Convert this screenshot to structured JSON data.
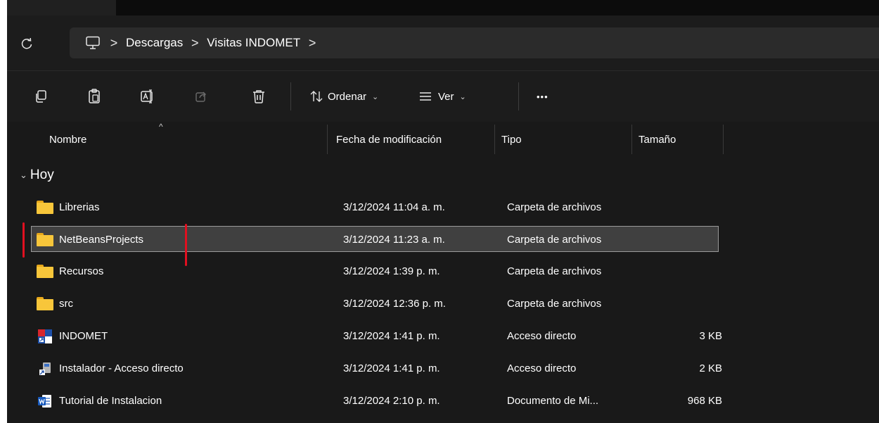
{
  "address": {
    "crumbs": [
      "Descargas",
      "Visitas INDOMET"
    ],
    "separator": ">"
  },
  "toolbar": {
    "sort_label": "Ordenar",
    "view_label": "Ver",
    "more_label": "•••"
  },
  "columns": {
    "name": "Nombre",
    "date": "Fecha de modificación",
    "type": "Tipo",
    "size": "Tamaño"
  },
  "group": {
    "label": "Hoy"
  },
  "files": [
    {
      "name": "Librerias",
      "date": "3/12/2024 11:04 a. m.",
      "type": "Carpeta de archivos",
      "size": "",
      "icon": "folder-icon"
    },
    {
      "name": "NetBeansProjects",
      "date": "3/12/2024 11:23 a. m.",
      "type": "Carpeta de archivos",
      "size": "",
      "icon": "folder-icon"
    },
    {
      "name": "Recursos",
      "date": "3/12/2024 1:39 p. m.",
      "type": "Carpeta de archivos",
      "size": "",
      "icon": "folder-icon"
    },
    {
      "name": "src",
      "date": "3/12/2024 12:36 p. m.",
      "type": "Carpeta de archivos",
      "size": "",
      "icon": "folder-icon"
    },
    {
      "name": "INDOMET",
      "date": "3/12/2024 1:41 p. m.",
      "type": "Acceso directo",
      "size": "3 KB",
      "icon": "shortcut-app-icon"
    },
    {
      "name": "Instalador - Acceso directo",
      "date": "3/12/2024 1:41 p. m.",
      "type": "Acceso directo",
      "size": "2 KB",
      "icon": "installer-shortcut-icon"
    },
    {
      "name": "Tutorial de Instalacion",
      "date": "3/12/2024 2:10 p. m.",
      "type": "Documento de Mi...",
      "size": "968 KB",
      "icon": "word-document-icon"
    }
  ],
  "colors": {
    "background": "#191919",
    "selection": "#404040",
    "folder": "#f8c63a",
    "annotation": "#e01020"
  }
}
